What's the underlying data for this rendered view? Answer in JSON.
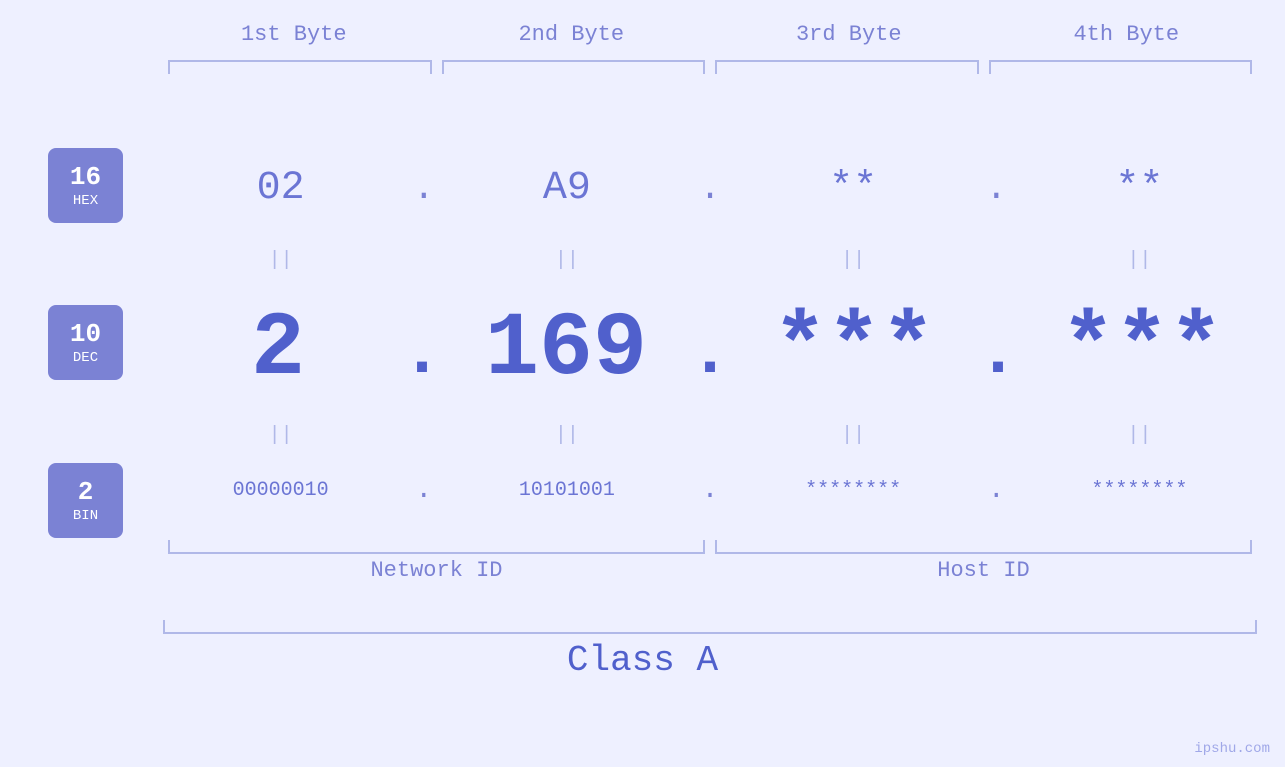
{
  "page": {
    "background": "#eef0ff",
    "watermark": "ipshu.com"
  },
  "byte_headers": {
    "b1": "1st Byte",
    "b2": "2nd Byte",
    "b3": "3rd Byte",
    "b4": "4th Byte"
  },
  "badges": {
    "hex": {
      "number": "16",
      "label": "HEX"
    },
    "dec": {
      "number": "10",
      "label": "DEC"
    },
    "bin": {
      "number": "2",
      "label": "BIN"
    }
  },
  "hex_values": {
    "b1": "02",
    "b2": "A9",
    "b3": "**",
    "b4": "**",
    "sep": "."
  },
  "dec_values": {
    "b1": "2",
    "b2": "169",
    "b3": "***",
    "b4": "***",
    "sep": "."
  },
  "bin_values": {
    "b1": "00000010",
    "b2": "10101001",
    "b3": "********",
    "b4": "********",
    "sep": "."
  },
  "equals_sign": "||",
  "labels": {
    "network_id": "Network ID",
    "host_id": "Host ID",
    "class": "Class A"
  }
}
